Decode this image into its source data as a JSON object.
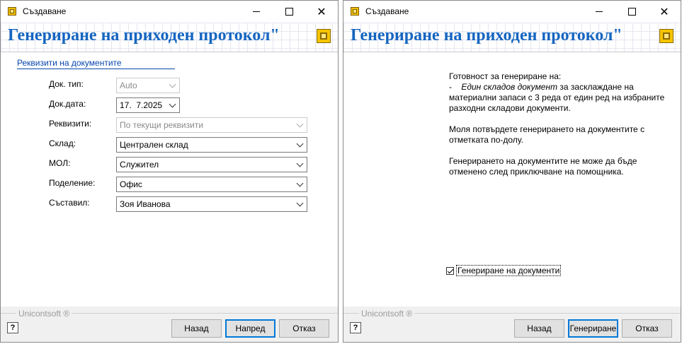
{
  "windows": [
    {
      "title": "Създаване",
      "header_title": "Генериране на приходен протокол\"",
      "section_link": "Реквизити на документите",
      "fields": [
        {
          "label": "Док. тип:",
          "value": "Auto",
          "disabled": true
        },
        {
          "label": "Док.дата:",
          "value": "17.  7.2025",
          "disabled": false
        },
        {
          "label": "Реквизити:",
          "value": "По текущи реквизити",
          "disabled": true
        },
        {
          "label": "Склад:",
          "value": "Централен склад",
          "disabled": false
        },
        {
          "label": "МОЛ:",
          "value": "Служител",
          "disabled": false
        },
        {
          "label": "Поделение:",
          "value": "Офис",
          "disabled": false
        },
        {
          "label": "Съставил:",
          "value": "Зоя Иванова",
          "disabled": false
        }
      ],
      "brand": "Unicontsoft ®",
      "buttons": {
        "back": "Назад",
        "next": "Напред",
        "cancel": "Отказ"
      }
    },
    {
      "title": "Създаване",
      "header_title": "Генериране на приходен протокол\"",
      "message": {
        "line1": "Готовност за генериране на:",
        "bullet_prefix": "-",
        "bullet_italic": "Един складов документ",
        "bullet_rest": " за засклаждане на материални запаси с 3 реда от един ред на избраните разходни складови документи.",
        "para2": "Моля потвърдете генерирането на документите с отметката по-долу.",
        "para3": "Генерирането на документите не може да бъде отменено след приключване на помощника."
      },
      "checkbox_label": "Генериране на документи",
      "checkbox_checked": true,
      "brand": "Unicontsoft ®",
      "buttons": {
        "back": "Назад",
        "generate": "Генериране",
        "cancel": "Отказ"
      }
    }
  ]
}
